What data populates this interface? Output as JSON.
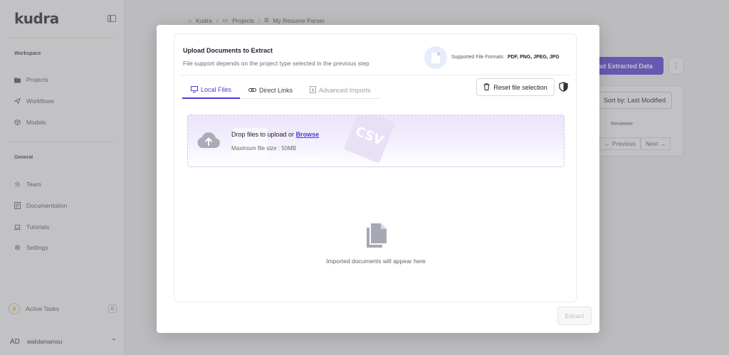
{
  "sidebar": {
    "logo": "kudra",
    "sections": {
      "workspace": "Workspace",
      "general": "General"
    },
    "workspace_items": [
      {
        "label": "Projects",
        "icon": "folder-icon"
      },
      {
        "label": "Workflows",
        "icon": "send-icon"
      },
      {
        "label": "Models",
        "icon": "cube-icon"
      }
    ],
    "general_items": [
      {
        "label": "Team",
        "icon": "team-icon"
      },
      {
        "label": "Documentation",
        "icon": "document-icon"
      },
      {
        "label": "Tutorials",
        "icon": "laptop-icon"
      },
      {
        "label": "Settings",
        "icon": "gear-icon"
      }
    ],
    "active_tasks": {
      "label": "Active Tasks",
      "count": "0"
    },
    "user": {
      "initials": "AD",
      "name": "walidamamou"
    }
  },
  "breadcrumb": [
    "Kudra",
    "Projects",
    "My Resume Parser"
  ],
  "background": {
    "upload_button": "oad Extracted Data",
    "sort_label": "Sort by: Last Modified",
    "reviewer_header": "Reviewer",
    "prev_label": "← Previous",
    "next_label": "Next →"
  },
  "modal": {
    "title": "Upload Documents to Extract",
    "subtitle": "File support depends on the project type selected in the previous step",
    "formats_label": "Supported File Formats : ",
    "formats_value": "PDF, PNG, JPEG, JPG",
    "tabs": [
      {
        "label": "Local Files",
        "state": "active"
      },
      {
        "label": "Direct Links",
        "state": "normal"
      },
      {
        "label": "Advanced Imports",
        "state": "disabled"
      }
    ],
    "reset_button": "Reset file selection",
    "dropzone": {
      "prompt": "Drop files to upload or ",
      "browse": "Browse",
      "max_size": "Maximum file size : 50MB",
      "deco_text": "CSV"
    },
    "empty_state": "Imported documents will appear here",
    "extract_button": "Extract"
  },
  "colors": {
    "accent": "#4b3bd6",
    "primary_button": "#5b3fe0",
    "dropzone_tint": "#ebe4fb"
  }
}
